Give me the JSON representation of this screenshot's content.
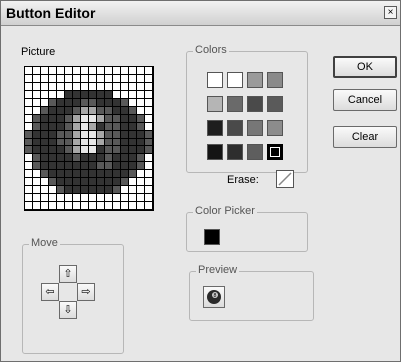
{
  "window": {
    "title": "Button Editor",
    "close_glyph": "×"
  },
  "picture": {
    "label": "Picture",
    "rows": [
      "0000000000000000",
      "0000000000000000",
      "0000000000000000",
      "0000022222200000",
      "0001222112221000",
      "0012221551122100",
      "0122215775112210",
      "0122215752112210",
      "1222115775112221",
      "1222115775112221",
      "1222215772112221",
      "0122221222122210",
      "0122222221122210",
      "0012222222222100",
      "0001222222221000",
      "0000122222210000",
      "0000000000000000",
      "0000000000000000"
    ],
    "palette": {
      "0": "#ffffff",
      "1": "#595959",
      "2": "#333333",
      "5": "#a7a7a7",
      "7": "#e7e7e7"
    }
  },
  "colors": {
    "label": "Colors",
    "swatches": [
      [
        "#ffffff",
        "#ffffff",
        "#9a9a9a",
        "#8a8a8a"
      ],
      [
        "#b5b5b5",
        "#6a6a6a",
        "#4a4a4a",
        "#5a5a5a"
      ],
      [
        "#1e1e1e",
        "#4a4a4a",
        "#777777",
        "#8c8c8c"
      ],
      [
        "#141414",
        "#2e2e2e",
        "#5e5e5e",
        "#000000"
      ]
    ],
    "erase_label": "Erase:"
  },
  "color_picker": {
    "label": "Color Picker",
    "current": "#000000"
  },
  "move": {
    "label": "Move",
    "up": "⇧",
    "left": "⇦",
    "right": "⇨",
    "down": "⇩"
  },
  "preview": {
    "label": "Preview"
  },
  "buttons": {
    "ok": "OK",
    "cancel": "Cancel",
    "clear": "Clear"
  }
}
